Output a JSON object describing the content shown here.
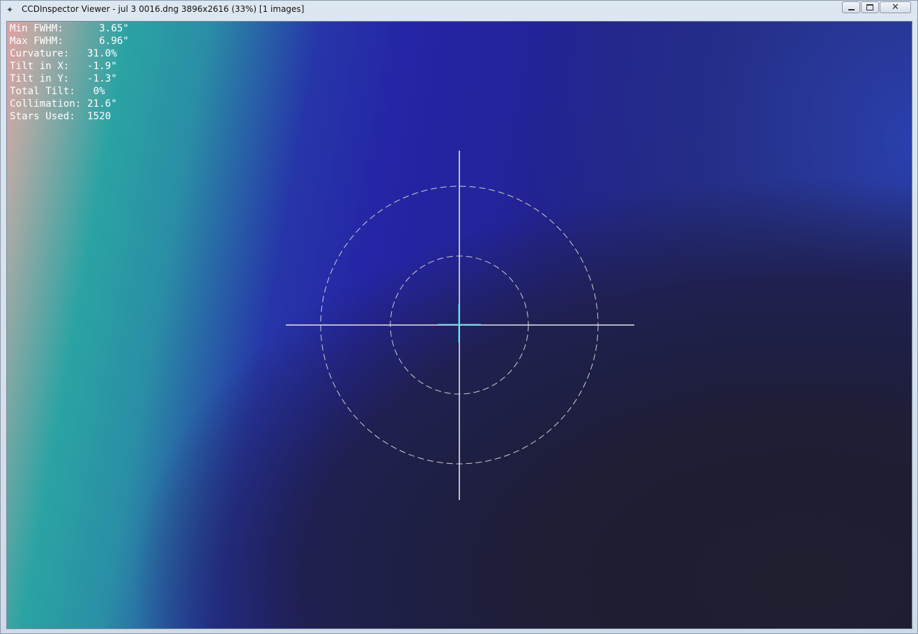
{
  "window": {
    "title": "CCDInspector Viewer - jul 3 0016.dng 3896x2616 (33%)  [1 images]",
    "minimize_label": "",
    "maximize_label": "",
    "close_glyph": "✕",
    "app_icon": "ccdinspector-app-icon"
  },
  "stats": [
    {
      "label": "Min FWHM:",
      "value": "3.65\"",
      "row": "Min FWHM:      3.65\""
    },
    {
      "label": "Max FWHM:",
      "value": "6.96\"",
      "row": "Max FWHM:      6.96\""
    },
    {
      "label": "Curvature:",
      "value": "31.0%",
      "row": "Curvature:   31.0%"
    },
    {
      "label": "Tilt in X:",
      "value": "-1.9\"",
      "row": "Tilt in X:   -1.9\""
    },
    {
      "label": "Tilt in Y:",
      "value": "-1.3\"",
      "row": "Tilt in Y:   -1.3\""
    },
    {
      "label": "Total Tilt:",
      "value": "0%",
      "row": "Total Tilt:   0%"
    },
    {
      "label": "Collimation:",
      "value": "21.6\"",
      "row": "Collimation: 21.6\""
    },
    {
      "label": "Stars Used:",
      "value": "1520",
      "row": "Stars Used:  1520"
    }
  ],
  "colors": {
    "crosshair": "#e6e6e6",
    "rings": "#cfcfcf",
    "offset_marker": "#29d3e8",
    "text": "#ffffff"
  }
}
